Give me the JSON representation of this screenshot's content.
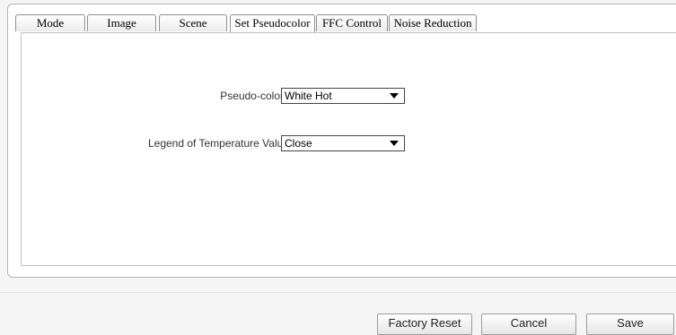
{
  "tabs": [
    {
      "label": "Mode"
    },
    {
      "label": "Image"
    },
    {
      "label": "Scene"
    },
    {
      "label": "Set Pseudocolor",
      "active": true
    },
    {
      "label": "FFC Control"
    },
    {
      "label": "Noise Reduction"
    }
  ],
  "form": {
    "pseudo_colors": {
      "label": "Pseudo-colors",
      "value": "White Hot"
    },
    "legend": {
      "label": "Legend of Temperature Value",
      "value": "Close"
    }
  },
  "buttons": {
    "factory_reset": "Factory Reset",
    "cancel": "Cancel",
    "save": "Save"
  }
}
